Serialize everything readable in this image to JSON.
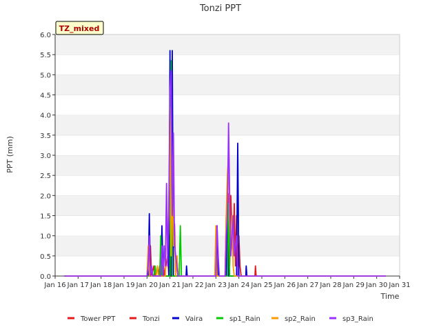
{
  "chart_data": {
    "type": "line",
    "title": "Tonzi PPT",
    "xlabel": "Time",
    "ylabel": "PPT (mm)",
    "badge": "TZ_mixed",
    "ylim": [
      0,
      6.0
    ],
    "xlim": [
      16,
      31
    ],
    "y_ticks": [
      "0.0",
      "0.5",
      "1.0",
      "1.5",
      "2.0",
      "2.5",
      "3.0",
      "3.5",
      "4.0",
      "4.5",
      "5.0",
      "5.5",
      "6.0"
    ],
    "x_ticks": [
      {
        "v": 16,
        "label": "Jan 16"
      },
      {
        "v": 17,
        "label": "Jan 17"
      },
      {
        "v": 18,
        "label": "Jan 18"
      },
      {
        "v": 19,
        "label": "Jan 19"
      },
      {
        "v": 20,
        "label": "Jan 20"
      },
      {
        "v": 21,
        "label": "Jan 21"
      },
      {
        "v": 22,
        "label": "Jan 22"
      },
      {
        "v": 23,
        "label": "Jan 23"
      },
      {
        "v": 24,
        "label": "Jan 24"
      },
      {
        "v": 25,
        "label": "Jan 25"
      },
      {
        "v": 26,
        "label": "Jan 26"
      },
      {
        "v": 27,
        "label": "Jan 27"
      },
      {
        "v": 28,
        "label": "Jan 28"
      },
      {
        "v": 29,
        "label": "Jan 29"
      },
      {
        "v": 30,
        "label": "Jan 30"
      },
      {
        "v": 31,
        "label": "Jan 31"
      }
    ],
    "grid": "horizontal",
    "legend_position": "bottom",
    "series": [
      {
        "name": "Tower PPT",
        "color": "#e31a1c",
        "points": [
          [
            16.4,
            0
          ],
          [
            23.0,
            0
          ],
          [
            23.05,
            0.25
          ],
          [
            23.1,
            0
          ]
        ]
      },
      {
        "name": "Tonzi",
        "color": "#e31a1c",
        "points": [
          [
            16.4,
            0
          ],
          [
            20.0,
            0
          ],
          [
            20.03,
            0.25
          ],
          [
            20.08,
            0
          ],
          [
            20.15,
            0.75
          ],
          [
            20.2,
            0
          ],
          [
            20.3,
            0.25
          ],
          [
            20.35,
            0
          ],
          [
            20.5,
            0
          ],
          [
            20.55,
            0.25
          ],
          [
            20.6,
            0
          ],
          [
            20.7,
            0.5
          ],
          [
            20.75,
            0
          ],
          [
            20.9,
            0.5
          ],
          [
            20.95,
            0
          ],
          [
            21.0,
            1.0
          ],
          [
            21.05,
            0.3
          ],
          [
            21.1,
            3.3
          ],
          [
            21.15,
            0.75
          ],
          [
            21.2,
            1.3
          ],
          [
            21.25,
            0
          ],
          [
            21.3,
            0.5
          ],
          [
            21.35,
            0
          ],
          [
            23.0,
            0
          ],
          [
            23.05,
            0.25
          ],
          [
            23.1,
            0
          ],
          [
            23.4,
            0
          ],
          [
            23.45,
            1.5
          ],
          [
            23.5,
            0.5
          ],
          [
            23.55,
            2.05
          ],
          [
            23.6,
            0.25
          ],
          [
            23.65,
            2.0
          ],
          [
            23.7,
            1.0
          ],
          [
            23.75,
            0.5
          ],
          [
            23.8,
            1.8
          ],
          [
            23.85,
            0.25
          ],
          [
            23.9,
            1.5
          ],
          [
            23.95,
            0.25
          ],
          [
            24.0,
            1.0
          ],
          [
            24.05,
            0.25
          ],
          [
            24.1,
            0
          ],
          [
            24.7,
            0
          ],
          [
            24.72,
            0.25
          ],
          [
            24.75,
            0
          ],
          [
            30.4,
            0
          ]
        ]
      },
      {
        "name": "Vaira",
        "color": "#0000cc",
        "points": [
          [
            16.4,
            0
          ],
          [
            20.05,
            0
          ],
          [
            20.1,
            1.55
          ],
          [
            20.15,
            0
          ],
          [
            20.6,
            0
          ],
          [
            20.65,
            1.25
          ],
          [
            20.7,
            0
          ],
          [
            20.95,
            0
          ],
          [
            21.0,
            5.6
          ],
          [
            21.05,
            0
          ],
          [
            21.1,
            5.6
          ],
          [
            21.15,
            0
          ],
          [
            21.7,
            0
          ],
          [
            21.72,
            0.25
          ],
          [
            21.75,
            0
          ],
          [
            23.0,
            0
          ],
          [
            23.05,
            1.25
          ],
          [
            23.1,
            0
          ],
          [
            23.45,
            0
          ],
          [
            23.5,
            2.0
          ],
          [
            23.55,
            0
          ],
          [
            23.9,
            0
          ],
          [
            23.95,
            3.3
          ],
          [
            24.0,
            0
          ],
          [
            24.3,
            0
          ],
          [
            24.32,
            0.25
          ],
          [
            24.35,
            0
          ],
          [
            30.4,
            0
          ]
        ]
      },
      {
        "name": "sp1_Rain",
        "color": "#00cc00",
        "points": [
          [
            16.4,
            0
          ],
          [
            20.3,
            0
          ],
          [
            20.35,
            0.25
          ],
          [
            20.4,
            0
          ],
          [
            20.55,
            0
          ],
          [
            20.6,
            1.0
          ],
          [
            20.65,
            0
          ],
          [
            21.0,
            0
          ],
          [
            21.05,
            5.35
          ],
          [
            21.1,
            0
          ],
          [
            21.4,
            0
          ],
          [
            21.45,
            1.25
          ],
          [
            21.5,
            0
          ],
          [
            23.5,
            0
          ],
          [
            23.55,
            1.8
          ],
          [
            23.6,
            0
          ],
          [
            30.4,
            0
          ]
        ]
      },
      {
        "name": "sp2_Rain",
        "color": "#ff9900",
        "points": [
          [
            16.4,
            0
          ],
          [
            20.0,
            0
          ],
          [
            20.05,
            0.75
          ],
          [
            20.1,
            0
          ],
          [
            20.4,
            0
          ],
          [
            20.45,
            0.25
          ],
          [
            20.5,
            0
          ],
          [
            20.8,
            0
          ],
          [
            20.85,
            2.05
          ],
          [
            20.9,
            0.5
          ],
          [
            20.95,
            1.5
          ],
          [
            21.0,
            4.2
          ],
          [
            21.05,
            0.5
          ],
          [
            21.1,
            2.5
          ],
          [
            21.15,
            0.75
          ],
          [
            21.2,
            1.0
          ],
          [
            21.25,
            0
          ],
          [
            21.3,
            0.5
          ],
          [
            21.35,
            0
          ],
          [
            22.95,
            0
          ],
          [
            23.0,
            1.25
          ],
          [
            23.05,
            0
          ],
          [
            23.4,
            0
          ],
          [
            23.45,
            1.5
          ],
          [
            23.5,
            2.5
          ],
          [
            23.55,
            3.05
          ],
          [
            23.6,
            1.25
          ],
          [
            23.65,
            0.75
          ],
          [
            23.7,
            1.5
          ],
          [
            23.75,
            0.25
          ],
          [
            23.8,
            0
          ],
          [
            30.4,
            0
          ]
        ]
      },
      {
        "name": "sp3_Rain",
        "color": "#9b30ff",
        "points": [
          [
            16.4,
            0
          ],
          [
            20.0,
            0
          ],
          [
            20.05,
            0.25
          ],
          [
            20.1,
            1.0
          ],
          [
            20.15,
            0
          ],
          [
            20.2,
            0.25
          ],
          [
            20.25,
            0
          ],
          [
            20.6,
            0
          ],
          [
            20.65,
            0.75
          ],
          [
            20.7,
            0
          ],
          [
            20.75,
            0.75
          ],
          [
            20.8,
            0.25
          ],
          [
            20.85,
            2.3
          ],
          [
            20.9,
            0.25
          ],
          [
            20.95,
            1.8
          ],
          [
            21.0,
            4.6
          ],
          [
            21.05,
            5.1
          ],
          [
            21.1,
            1.5
          ],
          [
            21.15,
            3.55
          ],
          [
            21.2,
            0.75
          ],
          [
            21.25,
            0.5
          ],
          [
            21.3,
            0.25
          ],
          [
            21.35,
            0
          ],
          [
            23.0,
            0
          ],
          [
            23.05,
            1.25
          ],
          [
            23.1,
            0.5
          ],
          [
            23.15,
            0
          ],
          [
            23.4,
            0
          ],
          [
            23.45,
            1.0
          ],
          [
            23.5,
            1.5
          ],
          [
            23.55,
            3.8
          ],
          [
            23.6,
            2.0
          ],
          [
            23.65,
            0.5
          ],
          [
            23.7,
            1.0
          ],
          [
            23.75,
            1.5
          ],
          [
            23.8,
            0.5
          ],
          [
            23.85,
            0.75
          ],
          [
            23.9,
            1.0
          ],
          [
            23.95,
            0
          ],
          [
            30.4,
            0
          ]
        ]
      }
    ]
  }
}
